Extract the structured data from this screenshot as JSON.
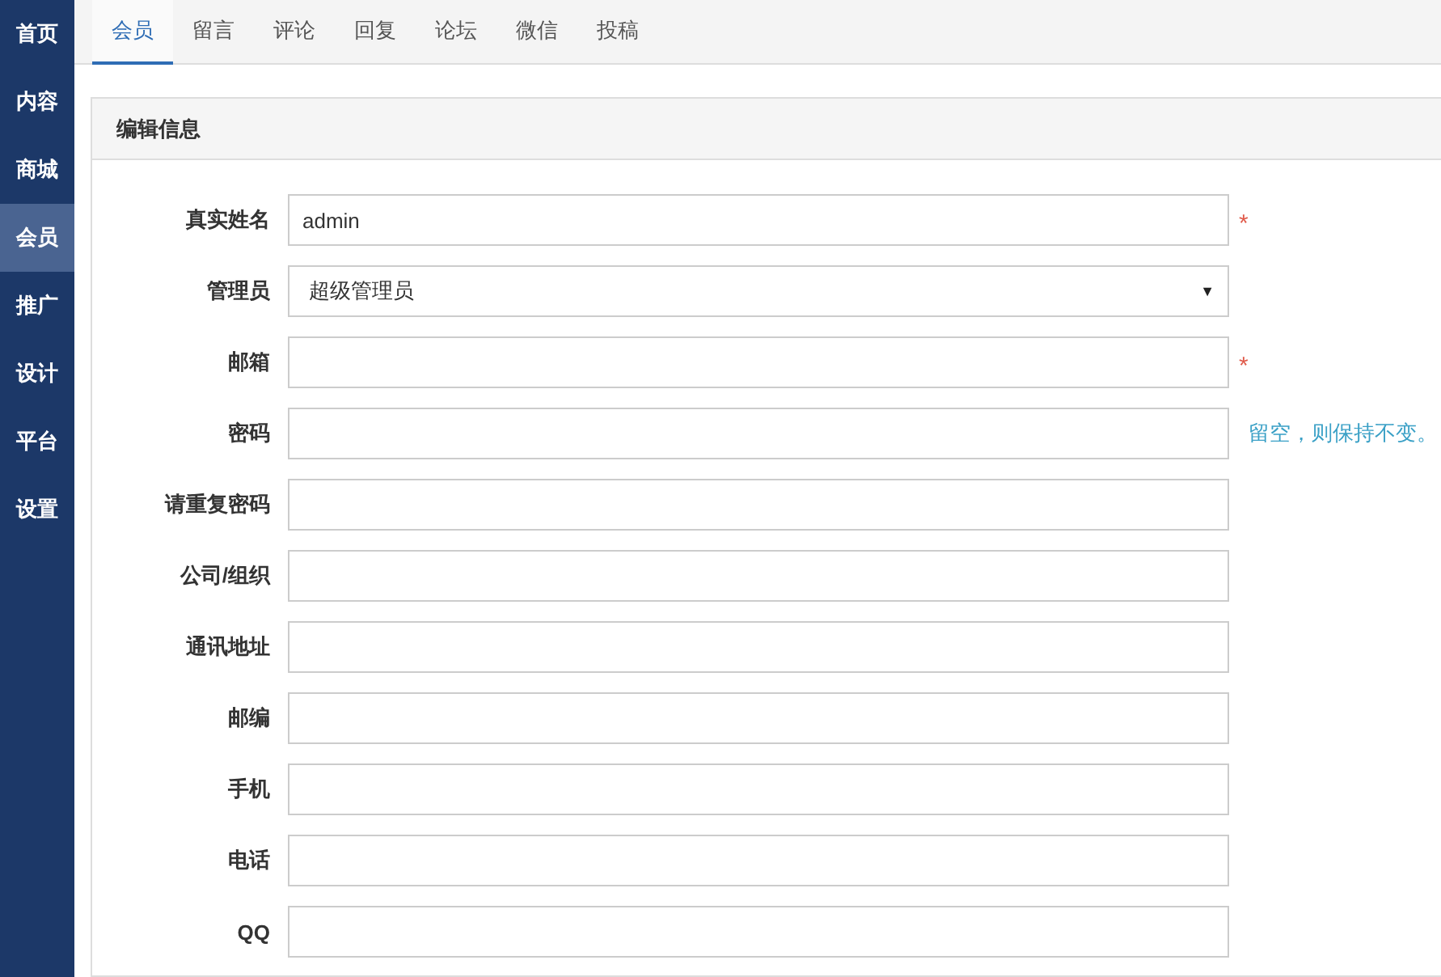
{
  "sidebar": {
    "items": [
      {
        "label": "首页",
        "selected": false
      },
      {
        "label": "内容",
        "selected": false
      },
      {
        "label": "商城",
        "selected": false
      },
      {
        "label": "会员",
        "selected": true
      },
      {
        "label": "推广",
        "selected": false
      },
      {
        "label": "设计",
        "selected": false
      },
      {
        "label": "平台",
        "selected": false
      },
      {
        "label": "设置",
        "selected": false
      }
    ]
  },
  "tabs": [
    {
      "label": "会员",
      "selected": true
    },
    {
      "label": "留言",
      "selected": false
    },
    {
      "label": "评论",
      "selected": false
    },
    {
      "label": "回复",
      "selected": false
    },
    {
      "label": "论坛",
      "selected": false
    },
    {
      "label": "微信",
      "selected": false
    },
    {
      "label": "投稿",
      "selected": false
    }
  ],
  "panel": {
    "title": "编辑信息",
    "fields": [
      {
        "label": "真实姓名",
        "kind": "text",
        "value": "admin",
        "note": {
          "kind": "required",
          "text": "*"
        }
      },
      {
        "label": "管理员",
        "kind": "select",
        "value": "超级管理员",
        "caret": "▼"
      },
      {
        "label": "邮箱",
        "kind": "text",
        "note": {
          "kind": "required",
          "text": "*"
        }
      },
      {
        "label": "密码",
        "kind": "text",
        "note": {
          "kind": "hint",
          "text": "留空，则保持不变。"
        }
      },
      {
        "label": "请重复密码",
        "kind": "text"
      },
      {
        "label": "公司/组织",
        "kind": "text"
      },
      {
        "label": "通讯地址",
        "kind": "text"
      },
      {
        "label": "邮编",
        "kind": "text"
      },
      {
        "label": "手机",
        "kind": "text"
      },
      {
        "label": "电话",
        "kind": "text"
      },
      {
        "label": "QQ",
        "kind": "text"
      }
    ]
  }
}
